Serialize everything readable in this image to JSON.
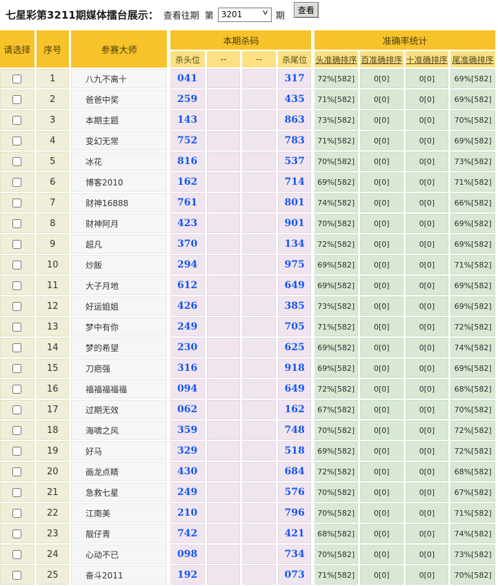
{
  "topbar": {
    "title": "七星彩第3211期媒体擂台展示：",
    "view_past": "查看往期",
    "period_prefix": "第",
    "period_value": "3201",
    "period_suffix": "期",
    "view_button": "查看"
  },
  "table": {
    "headers": {
      "select": "请选择",
      "index": "序号",
      "master": "参赛大师",
      "kill_group": "本期杀码",
      "kill_cols": [
        "杀头位",
        "--",
        "--",
        "杀尾位"
      ],
      "stats_group": "准确率统计",
      "stats_cols": [
        "头准确排序",
        "百准确排序",
        "十准确排序",
        "尾准确排序"
      ]
    },
    "rows": [
      {
        "index": "1",
        "master": "八九不离十",
        "kill_head": "041",
        "mid1": "",
        "mid2": "",
        "kill_tail": "317",
        "stat_head": "72%[582]",
        "stat_hundred": "0[0]",
        "stat_ten": "0[0]",
        "stat_tail": "69%[582]"
      },
      {
        "index": "2",
        "master": "爸爸中奖",
        "kill_head": "259",
        "mid1": "",
        "mid2": "",
        "kill_tail": "435",
        "stat_head": "71%[582]",
        "stat_hundred": "0[0]",
        "stat_ten": "0[0]",
        "stat_tail": "69%[582]"
      },
      {
        "index": "3",
        "master": "本期主题",
        "kill_head": "143",
        "mid1": "",
        "mid2": "",
        "kill_tail": "863",
        "stat_head": "73%[582]",
        "stat_hundred": "0[0]",
        "stat_ten": "0[0]",
        "stat_tail": "70%[582]"
      },
      {
        "index": "4",
        "master": "变幻无常",
        "kill_head": "752",
        "mid1": "",
        "mid2": "",
        "kill_tail": "783",
        "stat_head": "71%[582]",
        "stat_hundred": "0[0]",
        "stat_ten": "0[0]",
        "stat_tail": "69%[582]"
      },
      {
        "index": "5",
        "master": "冰花",
        "kill_head": "816",
        "mid1": "",
        "mid2": "",
        "kill_tail": "537",
        "stat_head": "70%[582]",
        "stat_hundred": "0[0]",
        "stat_ten": "0[0]",
        "stat_tail": "73%[582]"
      },
      {
        "index": "6",
        "master": "博客2010",
        "kill_head": "162",
        "mid1": "",
        "mid2": "",
        "kill_tail": "714",
        "stat_head": "69%[582]",
        "stat_hundred": "0[0]",
        "stat_ten": "0[0]",
        "stat_tail": "71%[582]"
      },
      {
        "index": "7",
        "master": "财神16888",
        "kill_head": "761",
        "mid1": "",
        "mid2": "",
        "kill_tail": "801",
        "stat_head": "74%[582]",
        "stat_hundred": "0[0]",
        "stat_ten": "0[0]",
        "stat_tail": "66%[582]"
      },
      {
        "index": "8",
        "master": "财神阿月",
        "kill_head": "423",
        "mid1": "",
        "mid2": "",
        "kill_tail": "901",
        "stat_head": "70%[582]",
        "stat_hundred": "0[0]",
        "stat_ten": "0[0]",
        "stat_tail": "69%[582]"
      },
      {
        "index": "9",
        "master": "超凡",
        "kill_head": "370",
        "mid1": "",
        "mid2": "",
        "kill_tail": "134",
        "stat_head": "72%[582]",
        "stat_hundred": "0[0]",
        "stat_ten": "0[0]",
        "stat_tail": "69%[582]"
      },
      {
        "index": "10",
        "master": "炒飯",
        "kill_head": "294",
        "mid1": "",
        "mid2": "",
        "kill_tail": "975",
        "stat_head": "69%[582]",
        "stat_hundred": "0[0]",
        "stat_ten": "0[0]",
        "stat_tail": "71%[582]"
      },
      {
        "index": "11",
        "master": "大子月地",
        "kill_head": "612",
        "mid1": "",
        "mid2": "",
        "kill_tail": "649",
        "stat_head": "69%[582]",
        "stat_hundred": "0[0]",
        "stat_ten": "0[0]",
        "stat_tail": "69%[582]"
      },
      {
        "index": "12",
        "master": "好运姐姐",
        "kill_head": "426",
        "mid1": "",
        "mid2": "",
        "kill_tail": "385",
        "stat_head": "73%[582]",
        "stat_hundred": "0[0]",
        "stat_ten": "0[0]",
        "stat_tail": "69%[582]"
      },
      {
        "index": "13",
        "master": "梦中有你",
        "kill_head": "249",
        "mid1": "",
        "mid2": "",
        "kill_tail": "705",
        "stat_head": "71%[582]",
        "stat_hundred": "0[0]",
        "stat_ten": "0[0]",
        "stat_tail": "72%[582]"
      },
      {
        "index": "14",
        "master": "梦的希望",
        "kill_head": "230",
        "mid1": "",
        "mid2": "",
        "kill_tail": "625",
        "stat_head": "69%[582]",
        "stat_hundred": "0[0]",
        "stat_ten": "0[0]",
        "stat_tail": "74%[582]"
      },
      {
        "index": "15",
        "master": "刀疤强",
        "kill_head": "316",
        "mid1": "",
        "mid2": "",
        "kill_tail": "918",
        "stat_head": "69%[582]",
        "stat_hundred": "0[0]",
        "stat_ten": "0[0]",
        "stat_tail": "69%[582]"
      },
      {
        "index": "16",
        "master": "福福福福福",
        "kill_head": "094",
        "mid1": "",
        "mid2": "",
        "kill_tail": "649",
        "stat_head": "72%[582]",
        "stat_hundred": "0[0]",
        "stat_ten": "0[0]",
        "stat_tail": "68%[582]"
      },
      {
        "index": "17",
        "master": "过期无效",
        "kill_head": "062",
        "mid1": "",
        "mid2": "",
        "kill_tail": "162",
        "stat_head": "67%[582]",
        "stat_hundred": "0[0]",
        "stat_ten": "0[0]",
        "stat_tail": "70%[582]"
      },
      {
        "index": "18",
        "master": "海啸之风",
        "kill_head": "359",
        "mid1": "",
        "mid2": "",
        "kill_tail": "748",
        "stat_head": "70%[582]",
        "stat_hundred": "0[0]",
        "stat_ten": "0[0]",
        "stat_tail": "72%[582]"
      },
      {
        "index": "19",
        "master": "好马",
        "kill_head": "329",
        "mid1": "",
        "mid2": "",
        "kill_tail": "518",
        "stat_head": "69%[582]",
        "stat_hundred": "0[0]",
        "stat_ten": "0[0]",
        "stat_tail": "72%[582]"
      },
      {
        "index": "20",
        "master": "画龙点睛",
        "kill_head": "430",
        "mid1": "",
        "mid2": "",
        "kill_tail": "684",
        "stat_head": "72%[582]",
        "stat_hundred": "0[0]",
        "stat_ten": "0[0]",
        "stat_tail": "68%[582]"
      },
      {
        "index": "21",
        "master": "急救七星",
        "kill_head": "249",
        "mid1": "",
        "mid2": "",
        "kill_tail": "576",
        "stat_head": "70%[582]",
        "stat_hundred": "0[0]",
        "stat_ten": "0[0]",
        "stat_tail": "67%[582]"
      },
      {
        "index": "22",
        "master": "江南美",
        "kill_head": "210",
        "mid1": "",
        "mid2": "",
        "kill_tail": "796",
        "stat_head": "70%[582]",
        "stat_hundred": "0[0]",
        "stat_ten": "0[0]",
        "stat_tail": "71%[582]"
      },
      {
        "index": "23",
        "master": "靓仔青",
        "kill_head": "742",
        "mid1": "",
        "mid2": "",
        "kill_tail": "421",
        "stat_head": "68%[582]",
        "stat_hundred": "0[0]",
        "stat_ten": "0[0]",
        "stat_tail": "74%[582]"
      },
      {
        "index": "24",
        "master": "心动不已",
        "kill_head": "098",
        "mid1": "",
        "mid2": "",
        "kill_tail": "734",
        "stat_head": "70%[582]",
        "stat_hundred": "0[0]",
        "stat_ten": "0[0]",
        "stat_tail": "73%[582]"
      },
      {
        "index": "25",
        "master": "奋斗2011",
        "kill_head": "192",
        "mid1": "",
        "mid2": "",
        "kill_tail": "073",
        "stat_head": "71%[582]",
        "stat_hundred": "0[0]",
        "stat_ten": "0[0]",
        "stat_tail": "70%[582]"
      }
    ]
  },
  "colors": {
    "gold": "#F8C32A",
    "goldText": "#4C3F0E",
    "subYellow": "#FBE183",
    "subText": "#544A1C",
    "cream": "#F0EDD8",
    "creamBorder": "#E2DFC2",
    "whiteCol": "#F6F6F6",
    "whiteColBorder": "#E8E8E8",
    "pink": "#F0E5EF",
    "pinkBorder": "#E2D6E1",
    "green": "#D9E8D4",
    "greenBorder": "#C9DEC4",
    "blue": "#1456F0"
  }
}
